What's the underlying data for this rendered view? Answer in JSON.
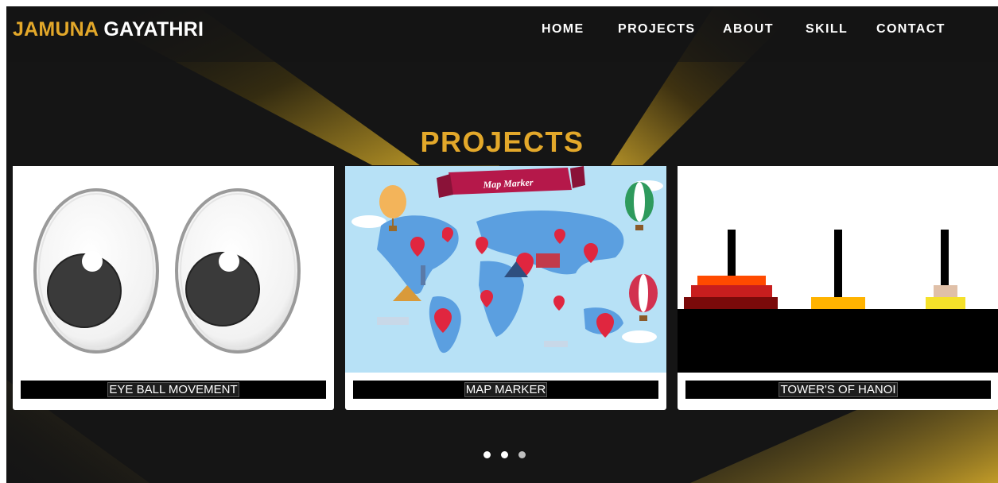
{
  "brand": {
    "first": "JAMUNA",
    "last": "GAYATHRI"
  },
  "nav": {
    "items": [
      {
        "label": "HOME"
      },
      {
        "label": "PROJECTS"
      },
      {
        "label": "ABOUT"
      },
      {
        "label": "SKILL"
      },
      {
        "label": "CONTACT"
      }
    ]
  },
  "section": {
    "title": "PROJECTS"
  },
  "projects": [
    {
      "title": "EYE BALL MOVEMENT"
    },
    {
      "title": "MAP MARKER",
      "banner": "Map Marker"
    },
    {
      "title": "TOWER'S OF HANOI"
    }
  ],
  "carousel": {
    "slides": 3,
    "active": 1
  },
  "colors": {
    "accent": "#e3a82a",
    "background": "#141414",
    "gold": "#c9a227"
  }
}
